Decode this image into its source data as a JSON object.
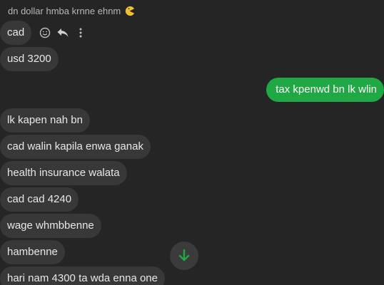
{
  "chat": {
    "header_text": "dn dollar hmba krnne ehnm",
    "messages": [
      {
        "text": "cad"
      },
      {
        "text": "usd 3200"
      },
      {
        "text": "tax kpenwd bn lk wlin"
      },
      {
        "text": "lk kapen nah bn"
      },
      {
        "text": "cad walin kapila enwa ganak"
      },
      {
        "text": "health insurance walata"
      },
      {
        "text": "cad cad 4240"
      },
      {
        "text": "wage whmbbenne"
      },
      {
        "text": "hambenne"
      },
      {
        "text": "hari nam 4300 ta wda enna one"
      }
    ]
  },
  "icons": {
    "header_emoji": "pacman-emoji-icon",
    "react": "smiley-icon",
    "reply": "reply-arrow-icon",
    "more": "more-vertical-icon",
    "scroll": "arrow-down-icon"
  },
  "colors": {
    "background": "#252526",
    "incoming_bubble": "#383838",
    "outgoing_bubble": "#1fa843",
    "scroll_arrow": "#1fa843"
  }
}
